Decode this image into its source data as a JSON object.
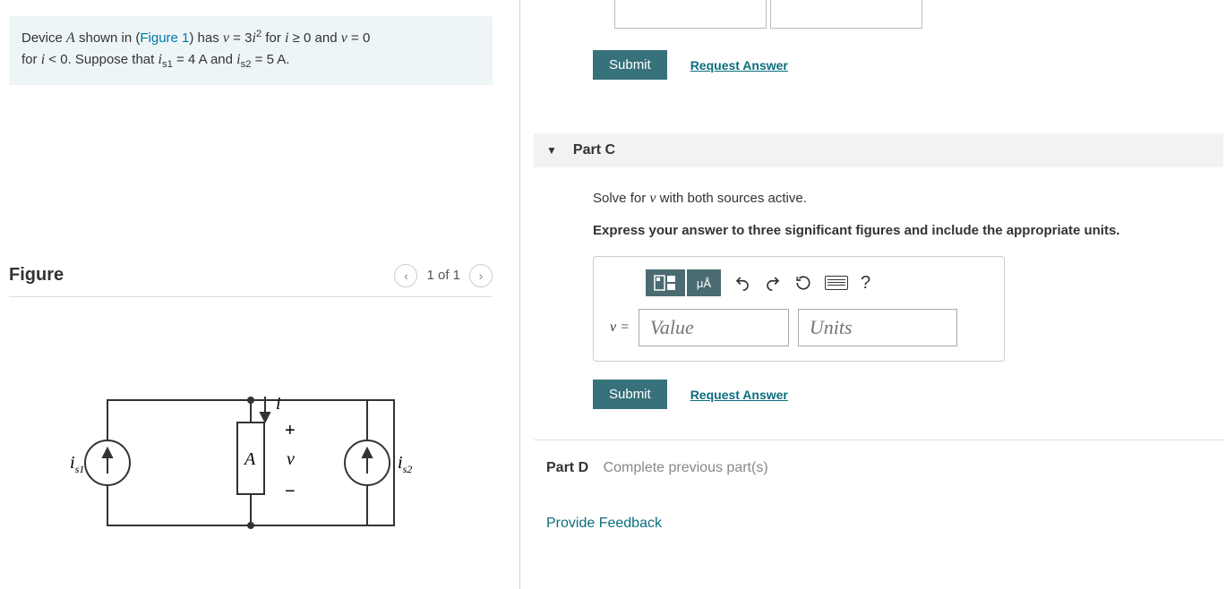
{
  "problem": {
    "prefix": "Device ",
    "varA": "A",
    "mid1": " shown in (",
    "figureLink": "Figure 1",
    "mid2": ") has ",
    "varV": "v",
    "eq1": " = 3",
    "varI": "i",
    "sq": "2",
    "mid3": " for ",
    "cond1": " ≥ 0 and ",
    "eq2": " = 0",
    "line2a": "for ",
    "cond2": " < 0. Suppose that ",
    "is1": "i",
    "is1sub": "s1",
    "is1val": " = 4 A ",
    "and": "and ",
    "is2": "i",
    "is2sub": "s2",
    "is2val": " = 5 A."
  },
  "figure": {
    "title": "Figure",
    "pager": "1 of 1",
    "labels": {
      "i": "i",
      "A": "A",
      "v": "v",
      "is1": "i",
      "is1sub": "s1",
      "is2": "i",
      "is2sub": "s2",
      "plus": "+",
      "minus": "−"
    }
  },
  "prevPart": {
    "submit": "Submit",
    "request": "Request Answer"
  },
  "partC": {
    "label": "Part C",
    "instruction_pre": "Solve for ",
    "instruction_var": "v",
    "instruction_post": " with both sources active.",
    "instruction2": "Express your answer to three significant figures and include the appropriate units.",
    "eqLabel": "v =",
    "valuePlaceholder": "Value",
    "unitsPlaceholder": "Units",
    "toolbarUA": "μÅ",
    "submit": "Submit",
    "request": "Request Answer"
  },
  "partD": {
    "label": "Part D",
    "status": "Complete previous part(s)"
  },
  "feedback": "Provide Feedback",
  "help": "?"
}
